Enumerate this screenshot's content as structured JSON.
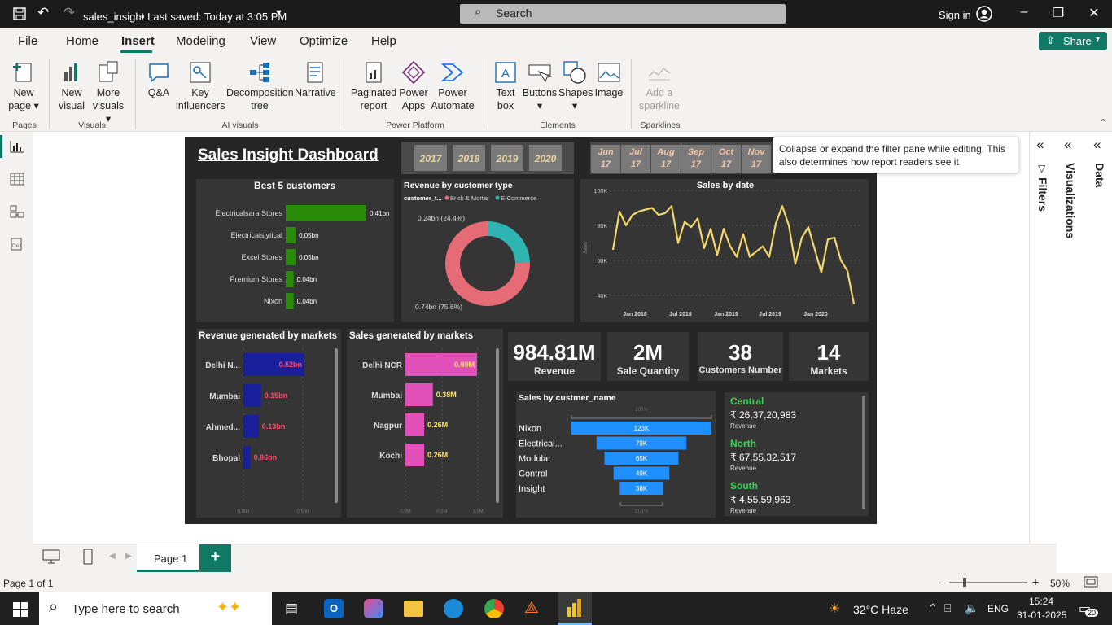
{
  "titlebar": {
    "file": "sales_insight",
    "saved": "• Last saved: Today at 3:05 PM",
    "search": "Search",
    "signin": "Sign in"
  },
  "menu": {
    "items": [
      "File",
      "Home",
      "Insert",
      "Modeling",
      "View",
      "Optimize",
      "Help"
    ],
    "active": "Insert",
    "share": "Share"
  },
  "ribbon": {
    "buttons": [
      {
        "l1": "New",
        "l2": "page ▾"
      },
      {
        "l1": "New",
        "l2": "visual"
      },
      {
        "l1": "More",
        "l2": "visuals ▾"
      },
      {
        "l1": "Q&A",
        "l2": ""
      },
      {
        "l1": "Key",
        "l2": "influencers"
      },
      {
        "l1": "Decomposition",
        "l2": "tree"
      },
      {
        "l1": "Narrative",
        "l2": ""
      },
      {
        "l1": "Paginated",
        "l2": "report"
      },
      {
        "l1": "Power",
        "l2": "Apps"
      },
      {
        "l1": "Power",
        "l2": "Automate"
      },
      {
        "l1": "Text",
        "l2": "box"
      },
      {
        "l1": "Buttons",
        "l2": "▾"
      },
      {
        "l1": "Shapes",
        "l2": "▾"
      },
      {
        "l1": "Image",
        "l2": ""
      },
      {
        "l1": "Add a",
        "l2": "sparkline"
      }
    ],
    "groups": [
      "Pages",
      "Visuals",
      "AI visuals",
      "Power Platform",
      "Elements",
      "Sparklines"
    ]
  },
  "tooltip": "Collapse or expand the filter pane while editing. This also determines how report readers see it",
  "panes": {
    "filters": "Filters",
    "visualizations": "Visualizations",
    "data": "Data"
  },
  "dashboard": {
    "title": "Sales Insight Dashboard",
    "years": [
      "2017",
      "2018",
      "2019",
      "2020"
    ],
    "months": [
      [
        "Jun",
        "17"
      ],
      [
        "Jul",
        "17"
      ],
      [
        "Aug",
        "17"
      ],
      [
        "Sep",
        "17"
      ],
      [
        "Oct",
        "17"
      ],
      [
        "Nov",
        "17"
      ]
    ],
    "kpis": [
      {
        "value": "984.81M",
        "label": "Revenue"
      },
      {
        "value": "2M",
        "label": "Sale Quantity"
      },
      {
        "value": "38",
        "label": "Customers Number"
      },
      {
        "value": "14",
        "label": "Markets"
      }
    ],
    "regions": [
      {
        "name": "Central",
        "value": "₹ 26,37,20,983",
        "sub": "Revenue"
      },
      {
        "name": "North",
        "value": "₹ 67,55,32,517",
        "sub": "Revenue"
      },
      {
        "name": "South",
        "value": "₹ 4,55,59,963",
        "sub": "Revenue"
      }
    ]
  },
  "chart_data": [
    {
      "type": "bar",
      "title": "Best 5 customers",
      "categories": [
        "Electricalsara Stores",
        "Electricalslytical",
        "Excel Stores",
        "Premium Stores",
        "Nixon"
      ],
      "values": [
        0.41,
        0.05,
        0.05,
        0.04,
        0.04
      ],
      "labels": [
        "0.41bn",
        "0.05bn",
        "0.05bn",
        "0.04bn",
        "0.04bn"
      ],
      "color": "#2a8a0a"
    },
    {
      "type": "pie",
      "title": "Revenue by customer type",
      "legend_title": "customer_t...",
      "series": [
        {
          "name": "Brick & Mortar",
          "value": 0.74,
          "label": "0.74bn (75.6%)",
          "color": "#e56b77"
        },
        {
          "name": "E-Commerce",
          "value": 0.24,
          "label": "0.24bn (24.4%)",
          "color": "#2eb5b1"
        }
      ]
    },
    {
      "type": "line",
      "title": "Sales by date",
      "ylabel": "Sales",
      "yticks": [
        "100K",
        "80K",
        "60K",
        "40K"
      ],
      "ylim": [
        32000,
        100000
      ],
      "xticks": [
        "Jan 2018",
        "Jul 2018",
        "Jan 2019",
        "Jul 2019",
        "Jan 2020"
      ],
      "values": [
        66000,
        88000,
        80000,
        86000,
        88000,
        89000,
        90000,
        86000,
        87000,
        91000,
        70000,
        82000,
        79000,
        84000,
        67000,
        78000,
        63000,
        78000,
        68000,
        62000,
        75000,
        62000,
        65000,
        68000,
        62000,
        81000,
        91000,
        80000,
        58000,
        73000,
        79000,
        66000,
        53000,
        72000,
        73000,
        60000,
        54000,
        35000
      ],
      "color": "#f2d86b"
    },
    {
      "type": "bar",
      "title": "Revenue generated by markets",
      "categories": [
        "Delhi N...",
        "Mumbai",
        "Ahmed...",
        "Bhopal"
      ],
      "values": [
        0.52,
        0.15,
        0.13,
        0.06
      ],
      "labels": [
        "0.52bn",
        "0.15bn",
        "0.13bn",
        "0.06bn"
      ],
      "color": "#1a1f9c",
      "xticks": [
        "0.0bn",
        "0.5bn"
      ]
    },
    {
      "type": "bar",
      "title": "Sales generated by markets",
      "categories": [
        "Delhi NCR",
        "Mumbai",
        "Nagpur",
        "Kochi"
      ],
      "values": [
        0.99,
        0.38,
        0.26,
        0.26
      ],
      "labels": [
        "0.99M",
        "0.38M",
        "0.26M",
        "0.26M"
      ],
      "color": "#e050b8",
      "xticks": [
        "0.0M",
        "0.5M",
        "1.0M"
      ]
    },
    {
      "type": "bar",
      "title": "Sales by custmer_name",
      "categories": [
        "Nixon",
        "Electrical...",
        "Modular",
        "Control",
        "Insight"
      ],
      "values": [
        123,
        79,
        65,
        49,
        38
      ],
      "labels": [
        "123K",
        "79K",
        "65K",
        "49K",
        "38K"
      ],
      "top_label": "100%",
      "bottom_label": "31.1%",
      "color": "#1e90ff"
    }
  ],
  "bottom": {
    "page": "Page 1",
    "status": "Page 1 of 1",
    "zoom": "50%"
  },
  "taskbar": {
    "search": "Type here to search",
    "weather": "32°C  Haze",
    "lang": "ENG",
    "time": "15:24",
    "date": "31-01-2025",
    "badge": "20"
  }
}
